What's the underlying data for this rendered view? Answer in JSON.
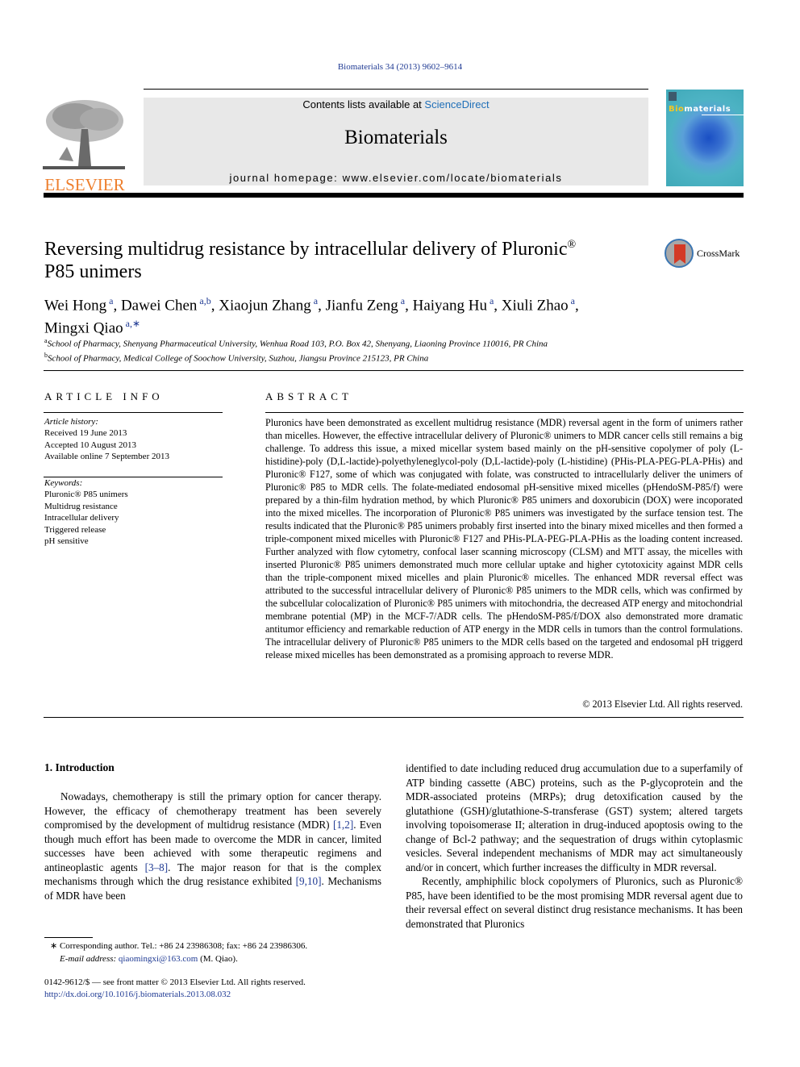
{
  "citation": "Biomaterials 34 (2013) 9602–9614",
  "masthead": {
    "contents_prefix": "Contents lists available at ",
    "contents_link": "ScienceDirect",
    "journal_name": "Biomaterials",
    "homepage": "journal homepage: www.elsevier.com/locate/biomaterials"
  },
  "publisher_logo": {
    "icon": "elsevier-tree-icon",
    "word": "ELSEVIER",
    "color": "#ee7f2d"
  },
  "cover": {
    "title_highlight": "Bio",
    "title_rest": "materials"
  },
  "crossmark": {
    "icon": "crossmark-icon",
    "label": "CrossMark"
  },
  "article": {
    "title_line1": "Reversing multidrug resistance by intracellular delivery of Pluronic",
    "title_reg": "®",
    "title_line2": "P85 unimers",
    "authors": [
      {
        "name": "Wei Hong",
        "aff": "a",
        "sep": ", "
      },
      {
        "name": "Dawei Chen",
        "aff": "a,b",
        "sep": ", "
      },
      {
        "name": "Xiaojun Zhang",
        "aff": "a",
        "sep": ", "
      },
      {
        "name": "Jianfu Zeng",
        "aff": "a",
        "sep": ", "
      },
      {
        "name": "Haiyang Hu",
        "aff": "a",
        "sep": ", "
      },
      {
        "name": "Xiuli Zhao",
        "aff": "a",
        "sep": ","
      },
      {
        "name": "Mingxi Qiao",
        "aff": "a,∗",
        "sep": ""
      }
    ],
    "affiliations": [
      {
        "key": "a",
        "text": "School of Pharmacy, Shenyang Pharmaceutical University, Wenhua Road 103, P.O. Box 42, Shenyang, Liaoning Province 110016, PR China"
      },
      {
        "key": "b",
        "text": "School of Pharmacy, Medical College of Soochow University, Suzhou, Jiangsu Province 215123, PR China"
      }
    ]
  },
  "article_info": {
    "heading": "ARTICLE INFO",
    "history_label": "Article history:",
    "history": [
      "Received 19 June 2013",
      "Accepted 10 August 2013",
      "Available online 7 September 2013"
    ],
    "keywords_label": "Keywords:",
    "keywords": [
      "Pluronic® P85 unimers",
      "Multidrug resistance",
      "Intracellular delivery",
      "Triggered release",
      "pH sensitive"
    ]
  },
  "abstract": {
    "heading": "ABSTRACT",
    "text": "Pluronics have been demonstrated as excellent multidrug resistance (MDR) reversal agent in the form of unimers rather than micelles. However, the effective intracellular delivery of Pluronic® unimers to MDR cancer cells still remains a big challenge. To address this issue, a mixed micellar system based mainly on the pH-sensitive copolymer of poly (L-histidine)-poly (D,L-lactide)-polyethyleneglycol-poly (D,L-lactide)-poly (L-histidine) (PHis-PLA-PEG-PLA-PHis) and Pluronic® F127, some of which was conjugated with folate, was constructed to intracellularly deliver the unimers of Pluronic® P85 to MDR cells. The folate-mediated endosomal pH-sensitive mixed micelles (pHendoSM-P85/f) were prepared by a thin-film hydration method, by which Pluronic® P85 unimers and doxorubicin (DOX) were incoporated into the mixed micelles. The incorporation of Pluronic® P85 unimers was investigated by the surface tension test. The results indicated that the Pluronic® P85 unimers probably first inserted into the binary mixed micelles and then formed a triple-component mixed micelles with Pluronic® F127 and PHis-PLA-PEG-PLA-PHis as the loading content increased. Further analyzed with flow cytometry, confocal laser scanning microscopy (CLSM) and MTT assay, the micelles with inserted Pluronic® P85 unimers demonstrated much more cellular uptake and higher cytotoxicity against MDR cells than the triple-component mixed micelles and plain Pluronic® micelles. The enhanced MDR reversal effect was attributed to the successful intracellular delivery of Pluronic® P85 unimers to the MDR cells, which was confirmed by the subcellular colocalization of Pluronic® P85 unimers with mitochondria, the decreased ATP energy and mitochondrial membrane potential (MP) in the MCF-7/ADR cells. The pHendoSM-P85/f/DOX also demonstrated more dramatic antitumor efficiency and remarkable reduction of ATP energy in the MDR cells in tumors than the control formulations. The intracellular delivery of Pluronic® P85 unimers to the MDR cells based on the targeted and endosomal pH triggerd release mixed micelles has been demonstrated as a promising approach to reverse MDR.",
    "copyright": "© 2013 Elsevier Ltd. All rights reserved."
  },
  "introduction": {
    "heading": "1.  Introduction",
    "left_paragraph": [
      {
        "t": "Nowadays, chemotherapy is still the primary option for cancer therapy. However, the efficacy of chemotherapy treatment has been severely compromised by the development of multidrug resistance (MDR) "
      },
      {
        "ref": "[1,2]"
      },
      {
        "t": ". Even though much effort has been made to overcome the MDR in cancer, limited successes have been achieved with some therapeutic regimens and antineoplastic agents "
      },
      {
        "ref": "[3–8]"
      },
      {
        "t": ". The major reason for that is the complex mechanisms through which the drug resistance exhibited "
      },
      {
        "ref": "[9,10]"
      },
      {
        "t": ". Mechanisms of MDR have been"
      }
    ],
    "right_paragraph_1": "identified to date including reduced drug accumulation due to a superfamily of ATP binding cassette (ABC) proteins, such as the P-glycoprotein and the MDR-associated proteins (MRPs); drug detoxification caused by the glutathione (GSH)/glutathione-S-transferase (GST) system; altered targets involving topoisomerase II; alteration in drug-induced apoptosis owing to the change of Bcl-2 pathway; and the sequestration of drugs within cytoplasmic vesicles. Several independent mechanisms of MDR may act simultaneously and/or in concert, which further increases the difficulty in MDR reversal.",
    "right_paragraph_2": "Recently, amphiphilic block copolymers of Pluronics, such as Pluronic® P85, have been identified to be the most promising MDR reversal agent due to their reversal effect on several distinct drug resistance mechanisms. It has been demonstrated that Pluronics"
  },
  "footnote": {
    "marker": "∗",
    "corresponding": "Corresponding author. Tel.: +86 24 23986308; fax: +86 24 23986306.",
    "email_label": "E-mail address: ",
    "email": "qiaomingxi@163.com",
    "email_suffix": " (M. Qiao)."
  },
  "issn_line": "0142-9612/$ — see front matter © 2013 Elsevier Ltd. All rights reserved.",
  "doi": "http://dx.doi.org/10.1016/j.biomaterials.2013.08.032"
}
